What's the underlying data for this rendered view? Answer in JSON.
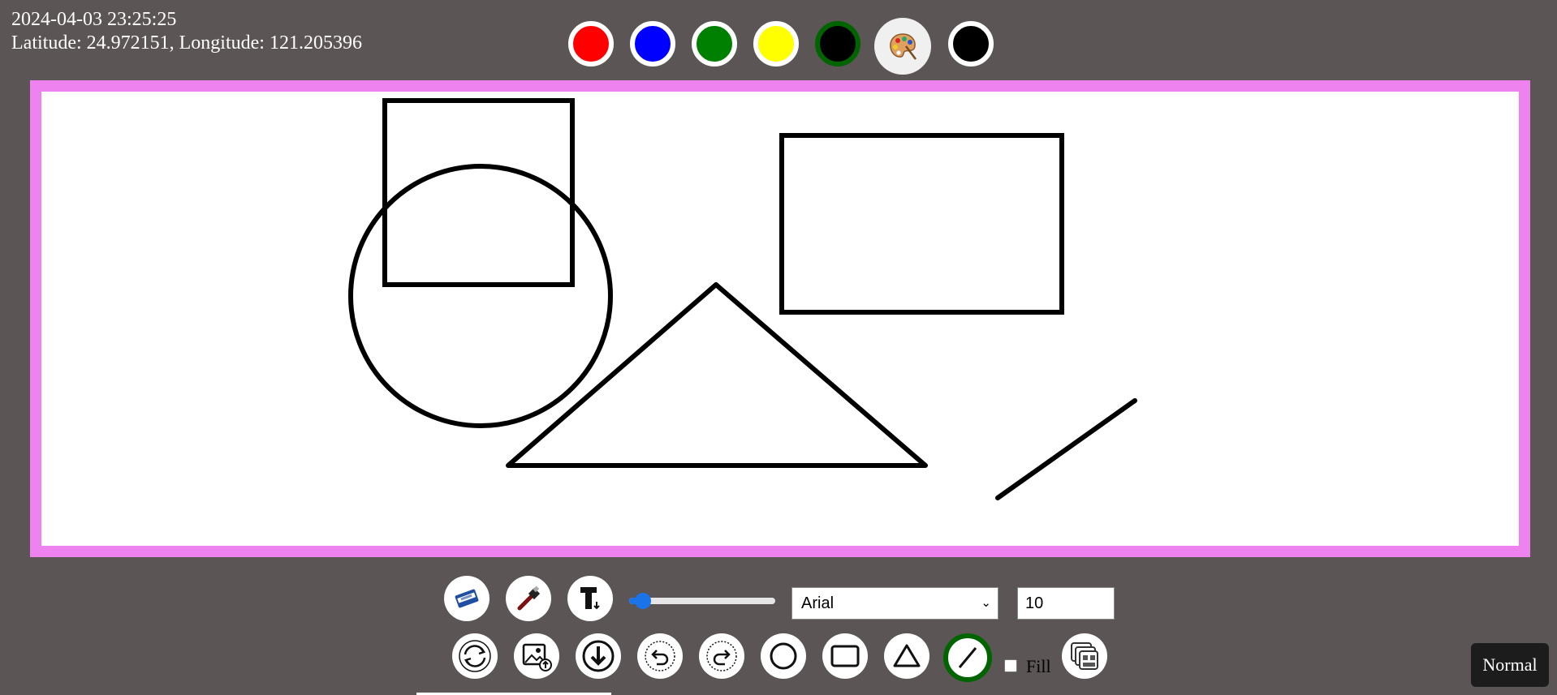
{
  "info": {
    "datetime": "2024-04-03 23:25:25",
    "location": "Latitude: 24.972151, Longitude: 121.205396"
  },
  "palette": {
    "colors": [
      {
        "name": "red",
        "hex": "#ff0000"
      },
      {
        "name": "blue",
        "hex": "#0000ff"
      },
      {
        "name": "green",
        "hex": "#008000"
      },
      {
        "name": "yellow",
        "hex": "#ffff00"
      },
      {
        "name": "black",
        "hex": "#000000",
        "selected": true
      },
      {
        "name": "black",
        "hex": "#000000"
      }
    ],
    "picker_icon": "palette-icon",
    "selected_ring_color": "#006400"
  },
  "canvas": {
    "border_color": "#ee82ee",
    "background": "#ffffff",
    "stroke_color": "#000000"
  },
  "toolbar": {
    "row1_tools": [
      "eraser-icon",
      "brush-icon",
      "text-tool-icon"
    ],
    "brush_size_fraction": 0.05,
    "font_family": "Arial",
    "font_size_value": "10",
    "row2_tools": [
      "reset-icon",
      "image-upload-icon",
      "download-icon",
      "undo-icon",
      "redo-icon",
      "circle-shape-icon",
      "rectangle-shape-icon",
      "triangle-shape-icon",
      "line-shape-icon"
    ],
    "fill_label": "Fill",
    "fill_checked": false,
    "layers_icon": "layers-icon"
  },
  "mode_badge": "Normal"
}
